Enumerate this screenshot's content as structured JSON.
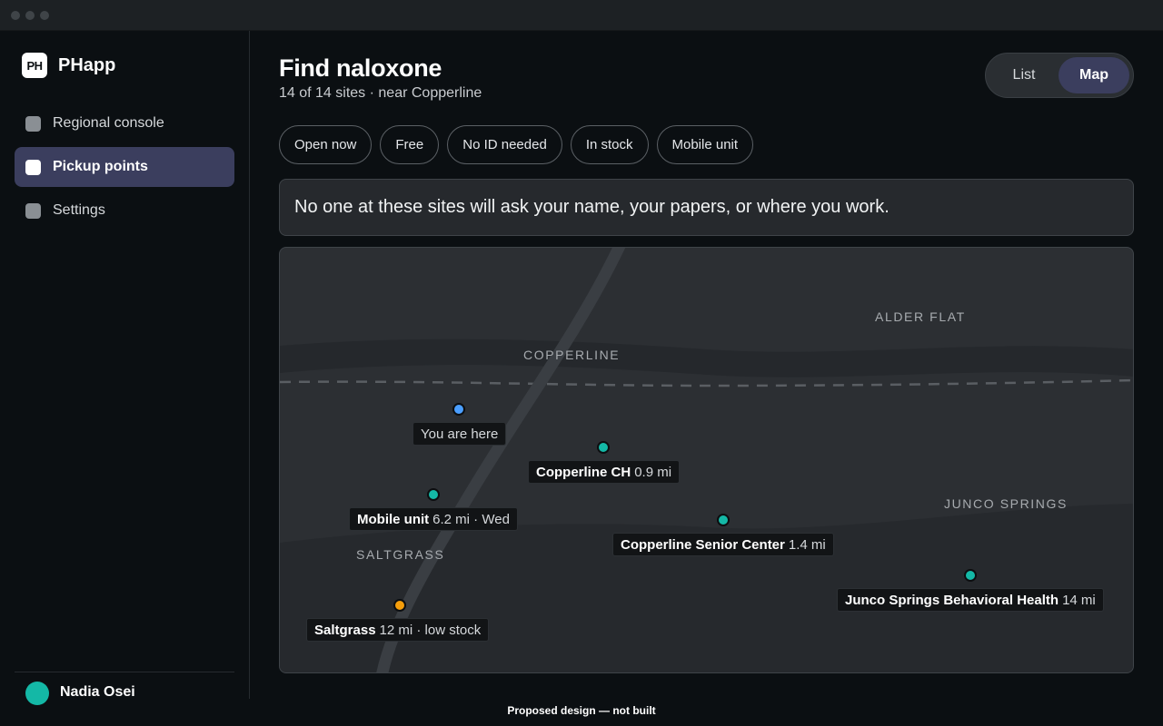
{
  "app": {
    "name": "PHapp",
    "logo_text": "PH"
  },
  "sidebar": {
    "items": [
      {
        "label": "Regional console",
        "active": false
      },
      {
        "label": "Pickup points",
        "active": true
      },
      {
        "label": "Settings",
        "active": false
      }
    ],
    "user": {
      "name": "Nadia Osei"
    }
  },
  "header": {
    "title": "Find naloxone",
    "subtitle": "14 of 14 sites · near Copperline",
    "view_toggle": {
      "list": "List",
      "map": "Map",
      "selected": "Map"
    }
  },
  "filters": [
    "Open now",
    "Free",
    "No ID needed",
    "In stock",
    "Mobile unit"
  ],
  "notice": "No one at these sites will ask your name, your papers, or where you work.",
  "map": {
    "areas": [
      "ALDER FLAT",
      "COPPERLINE",
      "JUNCO SPRINGS",
      "SALTGRASS"
    ],
    "you_are_here": "You are here",
    "sites": [
      {
        "name": "Copperline CH",
        "detail": "0.9 mi",
        "status_color": "#14b8a6"
      },
      {
        "name": "Mobile unit",
        "detail": "6.2 mi · Wed",
        "status_color": "#14b8a6"
      },
      {
        "name": "Copperline Senior Center",
        "detail": "1.4 mi",
        "status_color": "#14b8a6"
      },
      {
        "name": "Junco Springs Behavioral Health",
        "detail": "14 mi",
        "status_color": "#14b8a6"
      },
      {
        "name": "Saltgrass",
        "detail": "12 mi · low stock",
        "status_color": "#f59e0b"
      }
    ]
  },
  "footer": "Proposed design — not built",
  "colors": {
    "accent": "#3b3e5e",
    "in_stock": "#14b8a6",
    "low_stock": "#f59e0b",
    "user_location": "#4a9eff"
  }
}
